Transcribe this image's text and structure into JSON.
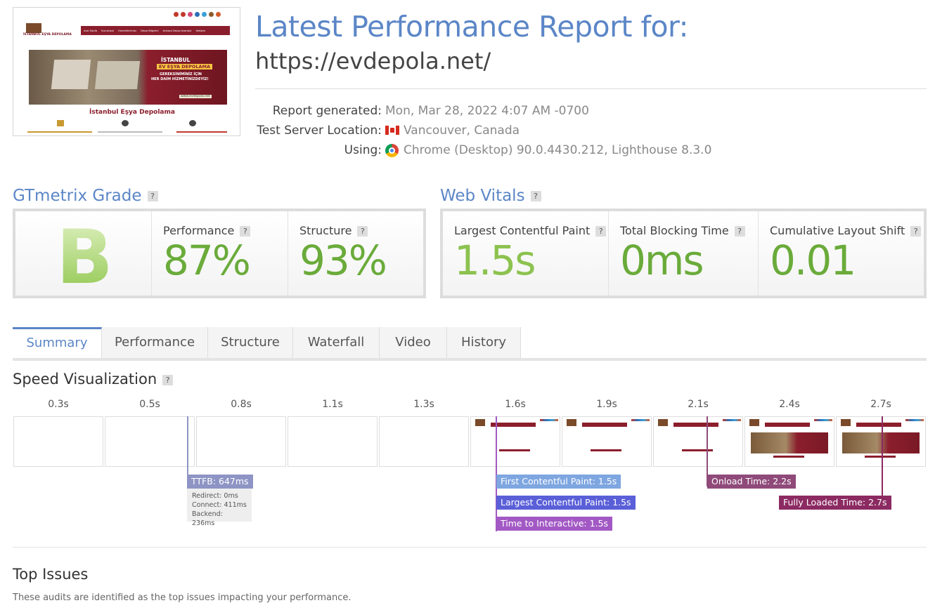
{
  "header": {
    "title": "Latest Performance Report for:",
    "url": "https://evdepola.net/",
    "thumbnail": {
      "nav_items": [
        "Ana Sayfa",
        "Kurumsal",
        "Hizmetlerimiz",
        "Depo Bilgileri",
        "Ankara Depo Istanbul",
        "İletişim"
      ],
      "hero_line1": "İSTANBUL",
      "hero_line2": "EV EŞYA DEPOLAMA",
      "hero_line3": "GEREKSİNİMİNİZ İÇİN",
      "hero_line4": "HER DAİM HİZMETİNİZDEYİZ!",
      "hero_url": "www.evdepola.net",
      "caption": "İstanbul Eşya Depolama",
      "logo_text": "İSTANBUL EŞYA DEPOLAMA"
    },
    "meta": [
      {
        "key": "Report generated:",
        "value": "Mon, Mar 28, 2022 4:07 AM -0700",
        "icon": "none"
      },
      {
        "key": "Test Server Location:",
        "value": "Vancouver, Canada",
        "icon": "canada-flag-icon"
      },
      {
        "key": "Using:",
        "value": "Chrome (Desktop) 90.0.4430.212, Lighthouse 8.3.0",
        "icon": "chrome-icon"
      }
    ]
  },
  "grade": {
    "heading": "GTmetrix Grade",
    "help": "?",
    "letter": "B",
    "performance_label": "Performance",
    "performance_value": "87%",
    "structure_label": "Structure",
    "structure_value": "93%"
  },
  "vitals": {
    "heading": "Web Vitals",
    "help": "?",
    "lcp_label": "Largest Contentful Paint",
    "lcp_value": "1.5s",
    "tbt_label": "Total Blocking Time",
    "tbt_value": "0ms",
    "cls_label": "Cumulative Layout Shift",
    "cls_value": "0.01"
  },
  "tabs": [
    {
      "label": "Summary",
      "active": true
    },
    {
      "label": "Performance",
      "active": false
    },
    {
      "label": "Structure",
      "active": false
    },
    {
      "label": "Waterfall",
      "active": false
    },
    {
      "label": "Video",
      "active": false
    },
    {
      "label": "History",
      "active": false
    }
  ],
  "speed": {
    "heading": "Speed Visualization",
    "help": "?",
    "ticks": [
      "0.3s",
      "0.5s",
      "0.8s",
      "1.1s",
      "1.3s",
      "1.6s",
      "1.9s",
      "2.1s",
      "2.4s",
      "2.7s"
    ],
    "frames": [
      "blank",
      "blank",
      "blank",
      "blank",
      "blank",
      "partial",
      "partial",
      "partial",
      "full",
      "full"
    ],
    "markers": {
      "ttfb": "TTFB: 647ms",
      "redirect": "Redirect: 0ms",
      "connect": "Connect: 411ms",
      "backend": "Backend: 236ms",
      "fcp": "First Contentful Paint: 1.5s",
      "lcp": "Largest Contentful Paint: 1.5s",
      "tti": "Time to Interactive: 1.5s",
      "onload": "Onload Time: 2.2s",
      "fully_loaded": "Fully Loaded Time: 2.7s"
    },
    "colors": {
      "ttfb": "#8e94c4",
      "fcp": "#7ea6e0",
      "lcp": "#5a5fd8",
      "tti": "#a259c4",
      "onload": "#8f4a7a",
      "fully_loaded": "#8c2a62"
    }
  },
  "issues": {
    "heading": "Top Issues",
    "subtitle": "These audits are identified as the top issues impacting your performance."
  }
}
